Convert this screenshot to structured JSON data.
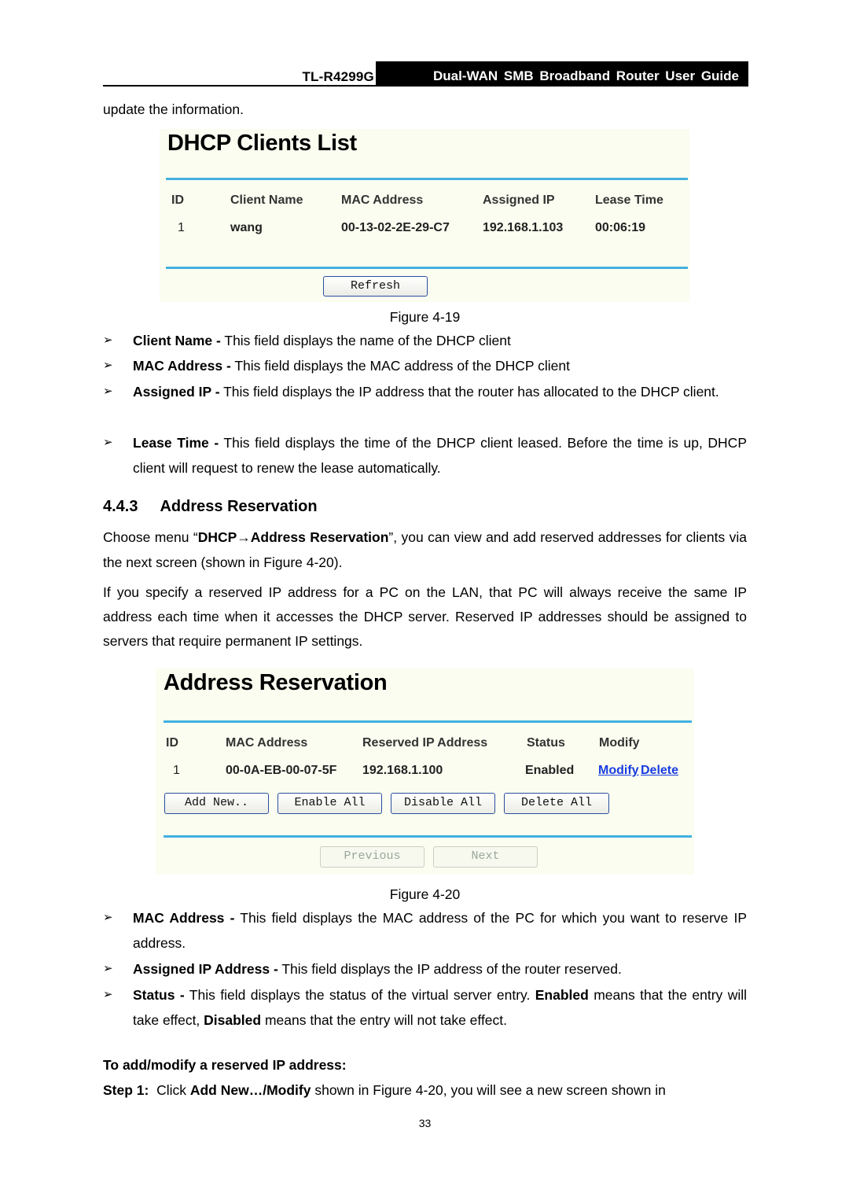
{
  "header": {
    "model": "TL-R4299G",
    "title": "Dual-WAN SMB Broadband Router User Guide"
  },
  "intro_text": "update the information.",
  "figure_4_19": {
    "title": "DHCP Clients List",
    "columns": [
      "ID",
      "Client Name",
      "MAC Address",
      "Assigned IP",
      "Lease Time"
    ],
    "rows": [
      {
        "id": "1",
        "client_name": "wang",
        "mac": "00-13-02-2E-29-C7",
        "ip": "192.168.1.103",
        "lease": "00:06:19"
      }
    ],
    "refresh_button": "Refresh",
    "caption": "Figure 4-19"
  },
  "bullets_4_19": [
    {
      "term": "Client Name -",
      "text": " This field displays the name of the DHCP client"
    },
    {
      "term": "MAC Address -",
      "text": " This field displays the MAC address of the DHCP client"
    },
    {
      "term": "Assigned IP -",
      "text": " This field displays the IP address that the router has allocated to the DHCP client."
    },
    {
      "term": "Lease Time -",
      "text": " This field displays the time of the DHCP client leased. Before the time is up, DHCP client will request to renew the lease automatically."
    }
  ],
  "section": {
    "number": "4.4.3",
    "title": "Address Reservation",
    "para1_prefix": "Choose menu “",
    "para1_menu": "DHCP→Address Reservation",
    "para1_suffix": "”, you can view and add reserved addresses for clients via the next screen (shown in Figure 4-20).",
    "para2": "If you specify a reserved IP address for a PC on the LAN, that PC will always receive the same IP address each time when it accesses the DHCP server. Reserved IP addresses should be assigned to servers that require permanent IP settings."
  },
  "figure_4_20": {
    "title": "Address Reservation",
    "columns": [
      "ID",
      "MAC Address",
      "Reserved IP Address",
      "Status",
      "Modify"
    ],
    "rows": [
      {
        "id": "1",
        "mac": "00-0A-EB-00-07-5F",
        "ip": "192.168.1.100",
        "status": "Enabled",
        "modify_link": "Modify",
        "delete_link": "Delete"
      }
    ],
    "buttons": {
      "add_new": "Add New..",
      "enable_all": "Enable All",
      "disable_all": "Disable All",
      "delete_all": "Delete All",
      "previous": "Previous",
      "next": "Next"
    },
    "caption": "Figure 4-20"
  },
  "bullets_4_20": [
    {
      "term": "MAC Address -",
      "text": " This field displays the MAC address of the PC for which you want to reserve IP address."
    },
    {
      "term": "Assigned IP Address -",
      "text": " This field displays the IP address of the router reserved."
    },
    {
      "term": "Status -",
      "text": " This field displays the status of the virtual server entry. ",
      "term2": "Enabled",
      "text2": " means that the entry will take effect, ",
      "term3": "Disabled",
      "text3": " means that the entry will not take effect."
    }
  ],
  "procedure": {
    "heading": "To add/modify a reserved IP address:",
    "step1_label": "Step 1:",
    "step1_pre": "  Click ",
    "step1_bold": "Add New…/Modify",
    "step1_post": " shown in Figure 4-20, you will see a new screen shown in"
  },
  "page_number": "33",
  "icons": {
    "bullet": "➢"
  },
  "colors": {
    "figure_bg": "#fbfdf0",
    "rule": "#41b0e0",
    "link": "#1a3de0",
    "button_border": "#2a4fa0"
  }
}
